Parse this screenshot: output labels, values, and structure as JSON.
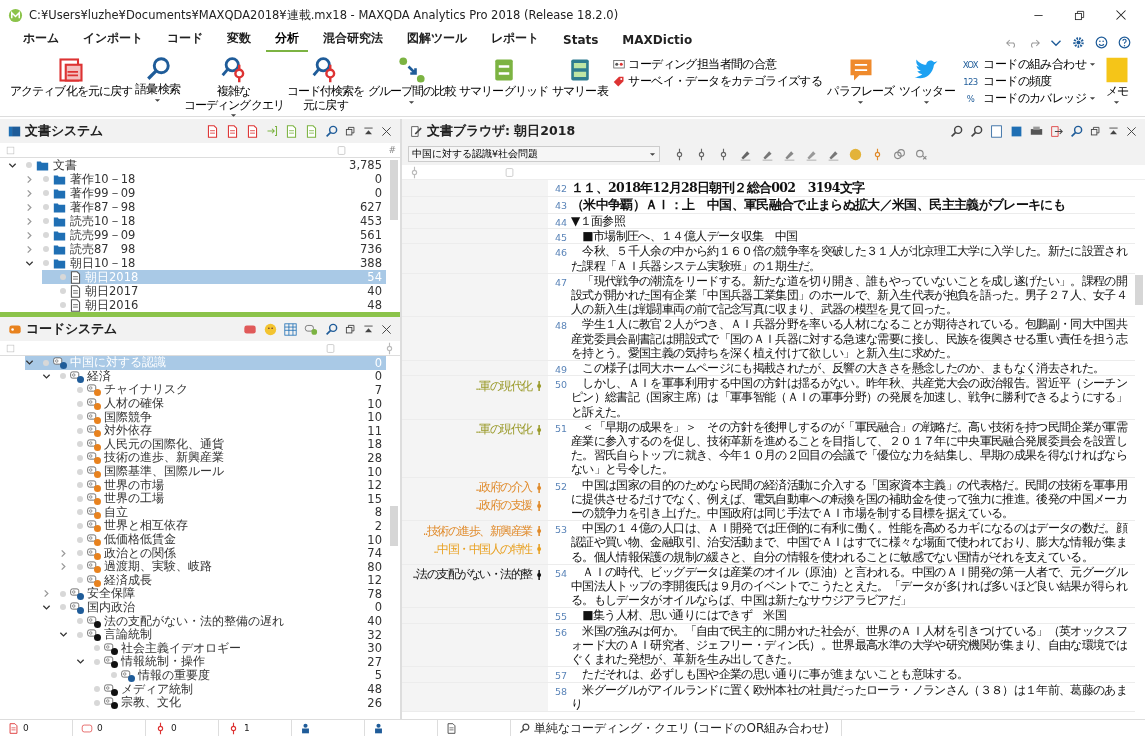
{
  "window": {
    "title": "C:¥Users¥luzhe¥Documents¥MAXQDA2018¥連載.mx18 - MAXQDA Analytics Pro 2018 (Release 18.2.0)"
  },
  "ribbon": {
    "tabs": [
      {
        "label": "ホーム",
        "selected": false
      },
      {
        "label": "インポート",
        "selected": false
      },
      {
        "label": "コード",
        "selected": false
      },
      {
        "label": "変数",
        "selected": false
      },
      {
        "label": "分析",
        "selected": true
      },
      {
        "label": "混合研究法",
        "selected": false
      },
      {
        "label": "図解ツール",
        "selected": false
      },
      {
        "label": "レポート",
        "selected": false
      },
      {
        "label": "Stats",
        "selected": false
      },
      {
        "label": "MAXDictio",
        "selected": false
      }
    ],
    "items": [
      {
        "kind": "large",
        "lines": [
          "アクティブ化を元に戻す"
        ],
        "caret": false
      },
      {
        "kind": "large",
        "lines": [
          "語彙検索"
        ],
        "caret": true
      },
      {
        "kind": "large",
        "lines": [
          "複雑な",
          "コーディングクエリ"
        ],
        "caret": true
      },
      {
        "kind": "large",
        "lines": [
          "コード付検索を",
          "元に戻す"
        ],
        "caret": false
      },
      {
        "kind": "large",
        "lines": [
          "グループ間の比較"
        ],
        "caret": true
      },
      {
        "kind": "large",
        "lines": [
          "サマリーグリッド"
        ],
        "caret": false
      },
      {
        "kind": "large",
        "lines": [
          "サマリー表"
        ],
        "caret": false
      },
      {
        "kind": "stack",
        "entries": [
          {
            "label": "コーディング担当者間の合意",
            "caret": false
          },
          {
            "label": "サーベイ・データをカテゴライズする",
            "caret": false
          }
        ]
      },
      {
        "kind": "large",
        "lines": [
          "パラフレーズ"
        ],
        "caret": true
      },
      {
        "kind": "large",
        "lines": [
          "ツイッター"
        ],
        "caret": true
      },
      {
        "kind": "stack",
        "entries": [
          {
            "prefix": "XOX",
            "label": "コードの組み合わせ",
            "caret": true
          },
          {
            "prefix": "123",
            "label": "コードの頻度",
            "caret": false
          },
          {
            "prefix": "%",
            "label": "コードのカバレッジ",
            "caret": true
          }
        ]
      },
      {
        "kind": "large",
        "lines": [
          "メモ"
        ],
        "caret": true
      }
    ]
  },
  "document_system": {
    "title": "文書システム",
    "count_header": "#",
    "tree": [
      {
        "kind": "folder",
        "label": "文書",
        "count": "3,785",
        "selected": false,
        "expanded": true,
        "children": [
          {
            "kind": "folder",
            "label": "著作10－18",
            "count": "0",
            "selected": false,
            "expanded": false
          },
          {
            "kind": "folder",
            "label": "著作99－09",
            "count": "0",
            "selected": false,
            "expanded": false
          },
          {
            "kind": "folder",
            "label": "著作87－98",
            "count": "627",
            "selected": false,
            "expanded": false
          },
          {
            "kind": "folder",
            "label": "読売10－18",
            "count": "453",
            "selected": false,
            "expanded": false
          },
          {
            "kind": "folder",
            "label": "読売99－09",
            "count": "561",
            "selected": false,
            "expanded": false
          },
          {
            "kind": "folder",
            "label": "読売87　98",
            "count": "736",
            "selected": false,
            "expanded": false
          },
          {
            "kind": "folder",
            "label": "朝日10－18",
            "count": "388",
            "selected": false,
            "expanded": true,
            "children": [
              {
                "kind": "document",
                "label": "朝日2018",
                "count": "54",
                "selected": true
              },
              {
                "kind": "document",
                "label": "朝日2017",
                "count": "40",
                "selected": false
              },
              {
                "kind": "document",
                "label": "朝日2016",
                "count": "48",
                "selected": false
              }
            ]
          }
        ]
      }
    ]
  },
  "code_system": {
    "title": "コードシステム",
    "tree": [
      {
        "label": "中国に対する認識",
        "count": "0",
        "color": "#1f5c99",
        "selected": true,
        "expanded": true,
        "children": [
          {
            "label": "経済",
            "count": "0",
            "color": "#1f5c99",
            "selected": false,
            "expanded": true,
            "children": [
              {
                "label": "チャイナリスク",
                "count": "7",
                "color": "#e8821e",
                "selected": false
              },
              {
                "label": "人材の確保",
                "count": "10",
                "color": "#e8821e",
                "selected": false
              },
              {
                "label": "国際競争",
                "count": "10",
                "color": "#e8821e",
                "selected": false
              },
              {
                "label": "対外依存",
                "count": "11",
                "color": "#e8821e",
                "selected": false
              },
              {
                "label": "人民元の国際化、通貨",
                "count": "18",
                "color": "#e8821e",
                "selected": false
              },
              {
                "label": "技術の進歩、新興産業",
                "count": "28",
                "color": "#e8821e",
                "selected": false
              },
              {
                "label": "国際基準、国際ルール",
                "count": "10",
                "color": "#e8821e",
                "selected": false
              },
              {
                "label": "世界の市場",
                "count": "12",
                "color": "#e8821e",
                "selected": false
              },
              {
                "label": "世界の工場",
                "count": "15",
                "color": "#e8821e",
                "selected": false
              },
              {
                "label": "自立",
                "count": "8",
                "color": "#e8821e",
                "selected": false
              },
              {
                "label": "世界と相互依存",
                "count": "2",
                "color": "#e8821e",
                "selected": false
              },
              {
                "label": "低価格低賃金",
                "count": "10",
                "color": "#e8821e",
                "selected": false
              },
              {
                "label": "政治との関係",
                "count": "74",
                "color": "#e8821e",
                "selected": false,
                "expanded": false
              },
              {
                "label": "過渡期、実験、岐路",
                "count": "80",
                "color": "#e8821e",
                "selected": false,
                "expanded": false
              },
              {
                "label": "経済成長",
                "count": "12",
                "color": "#e8821e",
                "selected": false
              }
            ]
          },
          {
            "label": "安全保障",
            "count": "78",
            "color": "#1f5c99",
            "selected": false,
            "expanded": false
          },
          {
            "label": "国内政治",
            "count": "0",
            "color": "#1f5c99",
            "selected": false,
            "expanded": true,
            "children": [
              {
                "label": "法の支配がない・法的整備の遅れ",
                "count": "40",
                "color": "#111111",
                "selected": false
              },
              {
                "label": "言論統制",
                "count": "32",
                "color": "#111111",
                "selected": false,
                "expanded": true,
                "children": [
                  {
                    "label": "社会主義イデオロギー",
                    "count": "30",
                    "color": "#111111",
                    "selected": false
                  },
                  {
                    "label": "情報統制・操作",
                    "count": "27",
                    "color": "#111111",
                    "selected": false,
                    "expanded": true,
                    "children": [
                      {
                        "label": "情報の重要度",
                        "count": "5",
                        "color": "#1f5c99",
                        "selected": false
                      }
                    ]
                  },
                  {
                    "label": "メディア統制",
                    "count": "48",
                    "color": "#111111",
                    "selected": false
                  },
                  {
                    "label": "宗教、文化",
                    "count": "26",
                    "color": "#111111",
                    "selected": false
                  }
                ]
              }
            ]
          }
        ]
      }
    ]
  },
  "browser": {
    "title": "文書ブラウザ: 朝日2018",
    "code_filter": "中国に対する認識¥社会問題",
    "paragraphs": [
      {
        "number": "42",
        "kind": "heading",
        "text": "１１、2018年12月28日朝刊２総合002　3194文字"
      },
      {
        "number": "43",
        "kind": "heading",
        "text": "（米中争覇）ＡＩ：上　中国、軍民融合で止まらぬ拡大／米国、民主主義がブレーキにも"
      },
      {
        "number": "44",
        "kind": "body",
        "text": "▼１面参照"
      },
      {
        "number": "45",
        "kind": "body",
        "text": "　■市場制圧へ、１４億人データ収集　中国"
      },
      {
        "number": "46",
        "kind": "body",
        "text": "　今秋、５千人余の中から約１６０倍の競争率を突破した３１人が北京理工大学に入学した。新たに設置された課程「ＡＩ兵器システム実験班」の１期生だ。"
      },
      {
        "number": "47",
        "kind": "body",
        "text": "　「現代戦争の潮流をリードする。新たな道を切り開き、誰もやっていないことを成し遂げたい」。課程の開設式が開かれた国有企業「中国兵器工業集団」のホールで、新入生代表が抱負を語った。男子２７人、女子４人の新入生は戦闘車両の前で記念写真に収まり、武器の模型を見て回った。"
      },
      {
        "number": "48",
        "kind": "body",
        "text": "　学生１人に教官２人がつき、ＡＩ兵器分野を率いる人材になることが期待されている。包鵬副・同大中国共産党委員会副書記は開設式で「国のＡＩ兵器に対する急速な需要に接し、民族を復興させる重い責任を担う志を持とう。愛国主義の気持ちを深く植え付けて欲しい」と新入生に求めた。"
      },
      {
        "number": "49",
        "kind": "body",
        "text": "　この様子は同大ホームページにも掲載されたが、反響の大きさを懸念したのか、まもなく消去された。"
      },
      {
        "number": "50",
        "kind": "body",
        "text": "　しかし、ＡＩを軍事利用する中国の方針は揺るがない。昨年秋、共産党大会の政治報告。習近平（シーチンピン）総書記（国家主席）は「軍事智能（ＡＩの軍事分野）の発展を加速し、戦争に勝利できるようにする」と訴えた。",
        "codes": [
          {
            "label": "..軍の現代化",
            "color": "#9a9a2a"
          }
        ]
      },
      {
        "number": "51",
        "kind": "body",
        "text": "　＜「早期の成果を」＞　その方針を後押しするのが「軍民融合」の戦略だ。高い技術を持つ民間企業が軍需産業に参入するのを促し、技術革新を進めることを目指して、２０１７年に中央軍民融合発展委員会を設置した。習氏自らトップに就き、今年１０月の２回目の会議で「優位な力を結集し、早期の成果を得なければならない」と号令した。",
        "codes": [
          {
            "label": "..軍の現代化",
            "color": "#9a9a2a"
          }
        ]
      },
      {
        "number": "52",
        "kind": "body",
        "text": "　中国は国家の目的のためなら民間の経済活動に介入する「国家資本主義」の代表格だ。民間の技術を軍事用に提供させるだけでなく、例えば、電気自動車への転換を国の補助金を使って強力に推進。後発の中国メーカーの競争力を引き上げた。中国政府は同じ手法でＡＩ市場を制する目標を据えている。",
        "codes": [
          {
            "label": "..政府の介入",
            "color": "#e08a2a"
          },
          {
            "label": "..政府の支援",
            "color": "#e08a2a"
          }
        ]
      },
      {
        "number": "53",
        "kind": "body",
        "text": "　中国の１４億の人口は、ＡＩ開発では圧倒的に有利に働く。性能を高めるカギになるのはデータの数だ。顔認証や買い物、金融取引、治安活動まで、中国でＡＩはすでに様々な場面で使われており、膨大な情報が集まる。個人情報保護の規制の緩さと、自分の情報を使われることに敏感でない国情がそれを支えている。",
        "codes": [
          {
            "label": "..技術の進歩、新興産業",
            "color": "#e08a2a"
          },
          {
            "label": "..中国・中国人の特性",
            "color": "#e8a020"
          }
        ]
      },
      {
        "number": "54",
        "kind": "body",
        "text": "　ＡＩの時代、ビッグデータは産業のオイル（原油）と言われる。中国のＡＩ開発の第一人者で、元グーグル中国法人トップの李開復氏は９月のイベントでこうたとえた。「データが多ければ多いほど良い結果が得られる。もしデータがオイルならば、中国は新たなサウジアラビアだ」",
        "codes": [
          {
            "label": "..法の支配がない・法的整",
            "color": "#111111"
          }
        ]
      },
      {
        "number": "55",
        "kind": "body",
        "text": "　■集う人材、思い通りにはできず　米国"
      },
      {
        "number": "56",
        "kind": "body",
        "text": "　米国の強みは何か。「自由で民主的に開かれた社会が、世界のＡＩ人材を引きつけている」（英オックスフォード大のＡＩ研究者、ジェフリー・ディン氏）。世界最高水準の大学や研究機関が集まり、自由な環境ではぐくまれた発想が、革新を生み出してきた。"
      },
      {
        "number": "57",
        "kind": "body",
        "text": "　ただそれは、必ずしも国や企業の思い通りに事が進まないことも意味する。"
      },
      {
        "number": "58",
        "kind": "body",
        "text": "　米グーグルがアイルランドに置く欧州本社の社員だったローラ・ノランさん（３８）は１年前、葛藤のあまり"
      }
    ]
  },
  "status_bar": {
    "counts": [
      "0",
      "0",
      "0",
      "1"
    ],
    "query": "単純なコーディング・クエリ (コードのOR組み合わせ)"
  }
}
